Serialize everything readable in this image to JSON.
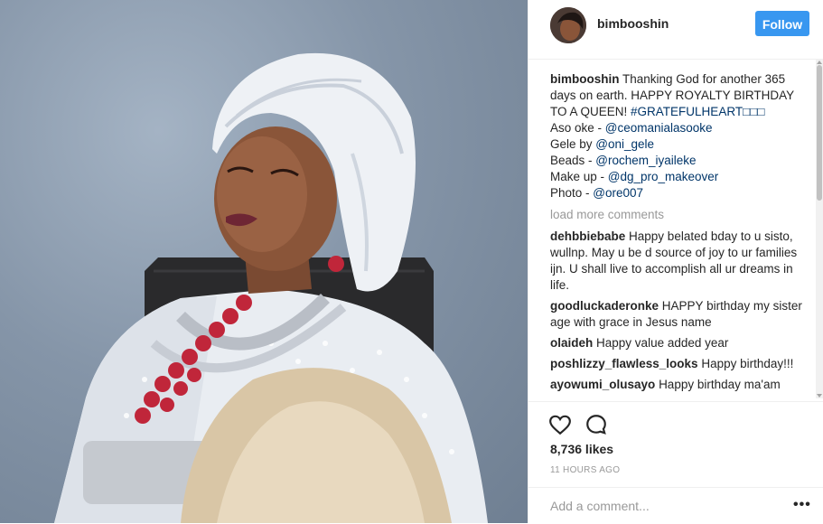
{
  "post": {
    "username": "bimbooshin",
    "follow_label": "Follow",
    "caption": {
      "username": "bimbooshin",
      "text": "Thanking God for another 365 days on earth. HAPPY ROYALTY BIRTHDAY TO A QUEEN!",
      "hashtag": "#GRATEFULHEART□□□",
      "credits": [
        {
          "label": "Aso oke - ",
          "handle": "@ceomanialasooke"
        },
        {
          "label": "Gele by ",
          "handle": "@oni_gele"
        },
        {
          "label": "Beads - ",
          "handle": "@rochem_iyaileke"
        },
        {
          "label": "Make up - ",
          "handle": "@dg_pro_makeover"
        },
        {
          "label": "Photo - ",
          "handle": "@ore007"
        }
      ]
    },
    "load_more": "load more comments",
    "comments": [
      {
        "user": "dehbbiebabe",
        "text": "Happy belated bday to u sisto, wullnp. May u be d source of joy to ur families ijn. U shall live to accomplish all ur dreams in life."
      },
      {
        "user": "goodluckaderonke",
        "text": "HAPPY birthday my sister age with grace in Jesus name"
      },
      {
        "user": "olaideh",
        "text": "Happy value added year"
      },
      {
        "user": "poshlizzy_flawless_looks",
        "text": "Happy birthday!!!"
      },
      {
        "user": "ayowumi_olusayo",
        "text": "Happy birthday ma'am"
      }
    ],
    "likes": "8,736 likes",
    "timestamp": "11 HOURS AGO",
    "add_comment_placeholder": "Add a comment...",
    "icons": {
      "like": "heart-icon",
      "comment": "comment-bubble-icon",
      "options": "more-options-icon"
    }
  },
  "colors": {
    "follow_button": "#3897f0",
    "mention": "#003569",
    "muted": "#999999"
  }
}
